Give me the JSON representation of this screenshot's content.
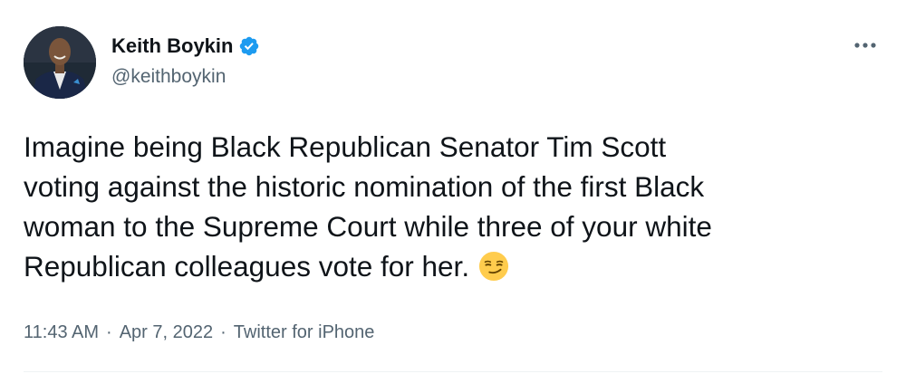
{
  "author": {
    "display_name": "Keith Boykin",
    "handle": "@keithboykin",
    "verified": true,
    "verified_color": "#1d9bf0"
  },
  "menu_icon": "more-horizontal-icon",
  "tweet": {
    "text": "Imagine being Black Republican Senator Tim Scott\nvoting against the historic nomination of the first Black\nwoman to the Supreme Court while three of your white\nRepublican colleagues vote for her.",
    "emoji": "smirking-face"
  },
  "meta": {
    "time": "11:43 AM",
    "separator": "·",
    "date": "Apr 7, 2022",
    "source": "Twitter for iPhone"
  }
}
